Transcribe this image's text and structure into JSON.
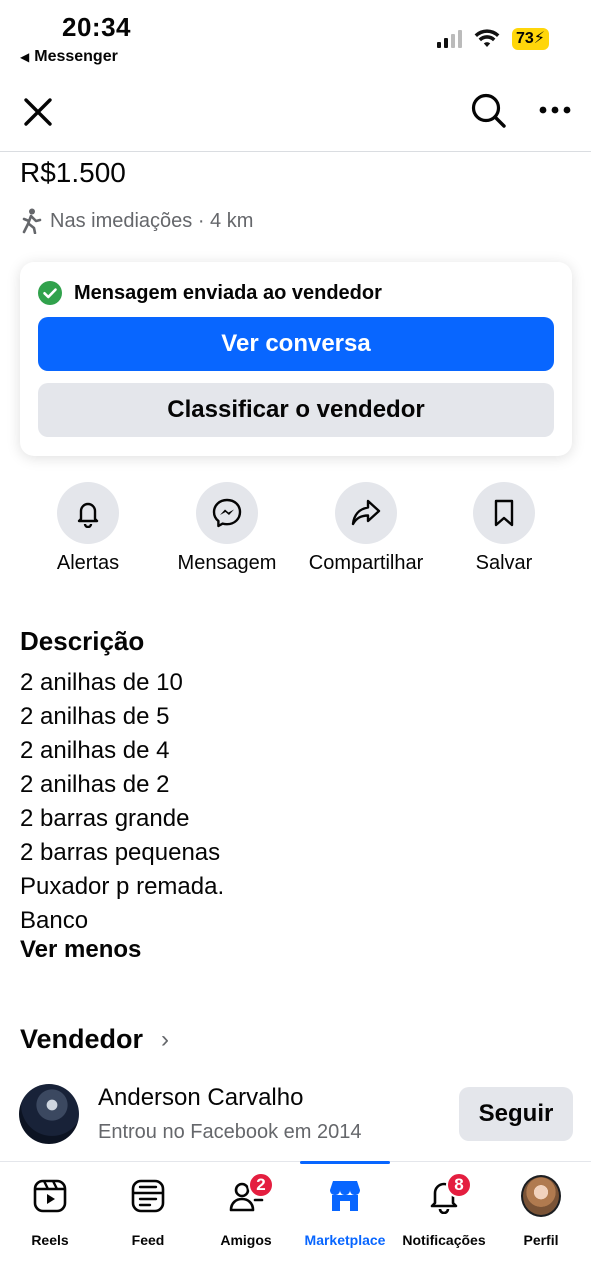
{
  "status_bar": {
    "time": "20:34",
    "back_app": "Messenger",
    "battery": "73"
  },
  "header": {
    "close_icon": "close-icon",
    "search_icon": "search-icon",
    "more_icon": "more-icon"
  },
  "listing": {
    "price": "R$1.500",
    "distance": "Nas imediações · 4 km"
  },
  "message_card": {
    "status": "Mensagem enviada ao vendedor",
    "primary_button": "Ver conversa",
    "secondary_button": "Classificar o vendedor"
  },
  "actions": [
    {
      "label": "Alertas",
      "icon": "bell-icon"
    },
    {
      "label": "Mensagem",
      "icon": "messenger-icon"
    },
    {
      "label": "Compartilhar",
      "icon": "share-icon"
    },
    {
      "label": "Salvar",
      "icon": "bookmark-icon"
    }
  ],
  "description": {
    "title": "Descrição",
    "lines": [
      "2 anilhas de 10",
      "2 anilhas de 5",
      "2 anilhas de 4",
      "2 anilhas de 2",
      "2 barras grande",
      "2 barras pequenas",
      "Puxador p remada.",
      "Banco"
    ],
    "toggle": "Ver menos"
  },
  "seller": {
    "section_title": "Vendedor",
    "name": "Anderson Carvalho",
    "joined": "Entrou no Facebook em 2014",
    "follow_label": "Seguir"
  },
  "tab_bar": {
    "tabs": [
      {
        "label": "Reels",
        "icon": "reels-icon",
        "badge": ""
      },
      {
        "label": "Feed",
        "icon": "feed-icon",
        "badge": ""
      },
      {
        "label": "Amigos",
        "icon": "friends-icon",
        "badge": "2"
      },
      {
        "label": "Marketplace",
        "icon": "marketplace-icon",
        "badge": "",
        "active": true
      },
      {
        "label": "Notificações",
        "icon": "notifications-icon",
        "badge": "8"
      },
      {
        "label": "Perfil",
        "icon": "profile-icon",
        "badge": ""
      }
    ]
  },
  "colors": {
    "accent": "#0866ff",
    "badge": "#e41e3f",
    "success": "#31a24c",
    "muted_text": "#65676b",
    "button_gray": "#e4e6eb"
  }
}
